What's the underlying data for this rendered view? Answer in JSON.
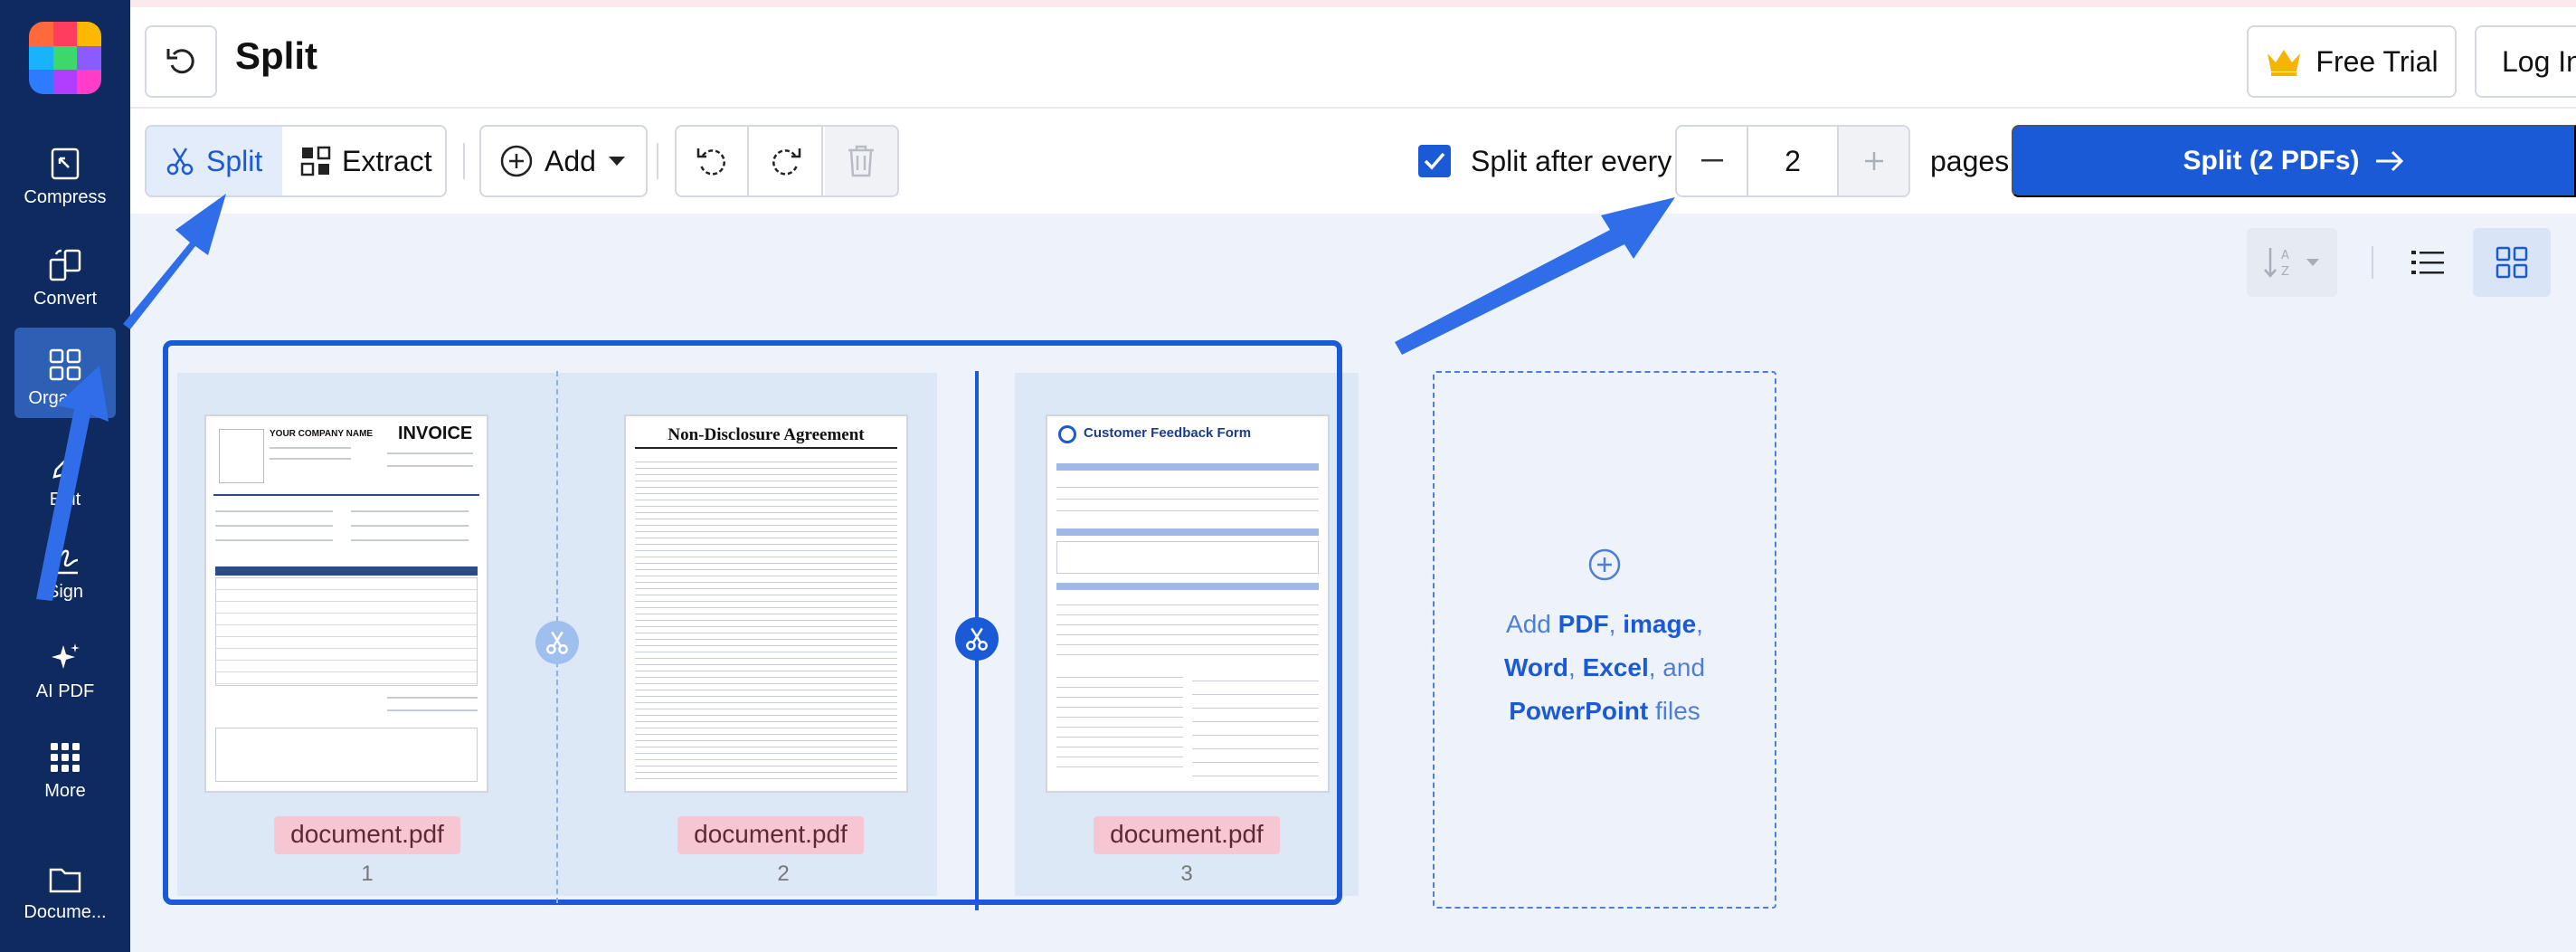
{
  "sidebar": {
    "items": [
      {
        "label": "Compress",
        "icon": "compress-icon"
      },
      {
        "label": "Convert",
        "icon": "convert-icon"
      },
      {
        "label": "Organize",
        "icon": "organize-icon",
        "active": true
      },
      {
        "label": "Edit",
        "icon": "edit-icon"
      },
      {
        "label": "Sign",
        "icon": "sign-icon"
      },
      {
        "label": "AI PDF",
        "icon": "ai-sparkle-icon"
      },
      {
        "label": "More",
        "icon": "more-grid-icon"
      },
      {
        "label": "Docume...",
        "icon": "folder-icon"
      }
    ]
  },
  "header": {
    "title": "Split",
    "free_trial": "Free Trial",
    "login": "Log In"
  },
  "toolbar": {
    "split_tab": "Split",
    "extract_tab": "Extract",
    "add_label": "Add",
    "split_after_label": "Split after every",
    "split_after_checked": true,
    "pages_value": "2",
    "pages_label": "pages",
    "split_action": "Split (2 PDFs)"
  },
  "documents": [
    {
      "filename": "document.pdf",
      "page": "1",
      "heading": "INVOICE",
      "company": "YOUR COMPANY NAME"
    },
    {
      "filename": "document.pdf",
      "page": "2",
      "heading": "Non-Disclosure Agreement"
    },
    {
      "filename": "document.pdf",
      "page": "3",
      "heading": "Customer Feedback Form"
    }
  ],
  "add_zone": {
    "prefix": "Add",
    "pdf": "PDF",
    "sep1": ",",
    "image": "image",
    "sep2": ",",
    "word": "Word",
    "sep3": ",",
    "excel": "Excel",
    "sep4": ", and",
    "powerpoint": "PowerPoint",
    "suffix": "files"
  },
  "colors": {
    "sidebar": "#0f2a5e",
    "accent": "#1b5ad6",
    "label_bg": "#f6c7d2"
  }
}
